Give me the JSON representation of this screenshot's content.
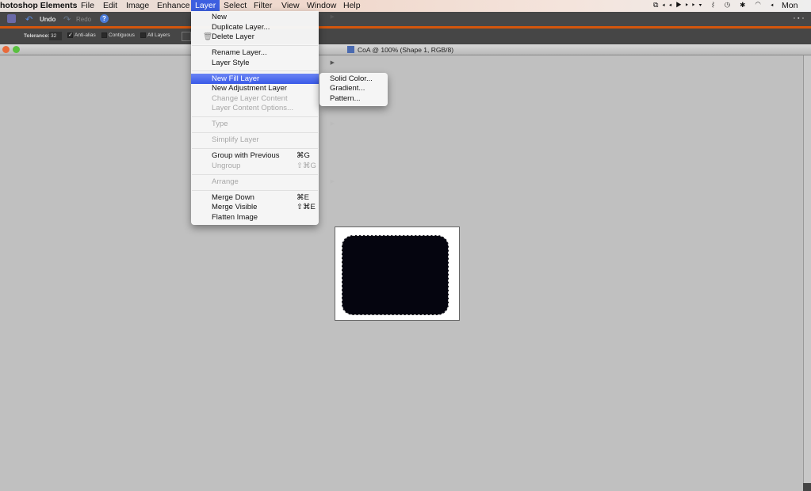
{
  "menubar": {
    "app": "hotoshop Elements",
    "items": [
      "File",
      "Edit",
      "Image",
      "Enhance",
      "Layer",
      "Select",
      "Filter",
      "View",
      "Window",
      "Help"
    ],
    "clock": "Mon Jun",
    "status_icons": [
      "spaces-icon",
      "rewind-icon",
      "play-icon",
      "fast-forward-icon",
      "dropdown-icon",
      "scanner-icon",
      "time-machine-icon",
      "bluetooth-icon",
      "wifi-icon",
      "volume-icon"
    ]
  },
  "toolbar": {
    "undo": "Undo",
    "redo": "Redo"
  },
  "options": {
    "tolerance_label": "Tolerance:",
    "tolerance_value": "32",
    "anti_alias": "Anti-alias",
    "anti_alias_checked": true,
    "contiguous": "Contiguous",
    "contiguous_checked": false,
    "all_layers": "All Layers",
    "all_layers_checked": false
  },
  "document": {
    "title": "CoA @ 100% (Shape 1, RGB/8)"
  },
  "layer_menu": {
    "items": [
      {
        "label": "New",
        "submenu": true
      },
      {
        "label": "Duplicate Layer..."
      },
      {
        "label": "Delete Layer"
      },
      {
        "label": "Rename Layer..."
      },
      {
        "label": "Layer Style",
        "submenu": true
      },
      {
        "label": "New Fill Layer",
        "submenu": true,
        "highlighted": true
      },
      {
        "label": "New Adjustment Layer",
        "submenu": true
      },
      {
        "label": "Change Layer Content",
        "submenu": true,
        "disabled": true
      },
      {
        "label": "Layer Content Options...",
        "disabled": true
      },
      {
        "label": "Type",
        "submenu": true,
        "disabled": true
      },
      {
        "label": "Simplify Layer",
        "disabled": true
      },
      {
        "label": "Group with Previous",
        "shortcut": "⌘G"
      },
      {
        "label": "Ungroup",
        "shortcut": "⇧⌘G",
        "disabled": true
      },
      {
        "label": "Arrange",
        "submenu": true,
        "disabled": true
      },
      {
        "label": "Merge Down",
        "shortcut": "⌘E"
      },
      {
        "label": "Merge Visible",
        "shortcut": "⇧⌘E"
      },
      {
        "label": "Flatten Image"
      }
    ]
  },
  "fill_submenu": {
    "items": [
      "Solid Color...",
      "Gradient...",
      "Pattern..."
    ]
  },
  "colors": {
    "accent": "#d4560c",
    "highlight": "#3d5fe0",
    "canvas": "#c0c0c0",
    "shape": "#05050f"
  }
}
